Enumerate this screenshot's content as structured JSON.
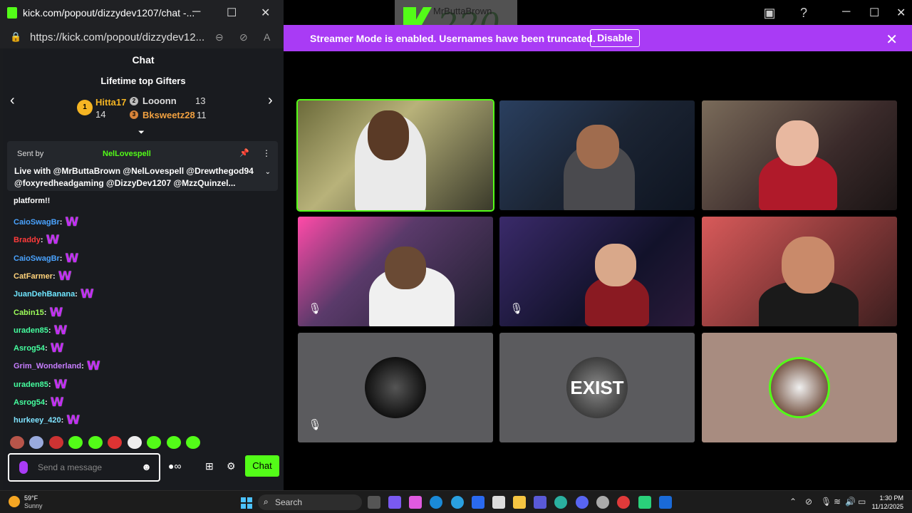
{
  "popout": {
    "window_title": "kick.com/popout/dizzydev1207/chat -...",
    "url": "https://kick.com/popout/dizzydev12...",
    "chat_title": "Chat",
    "lifetime_title": "Lifetime top Gifters",
    "gifters": [
      {
        "rank": "1",
        "name": "Hitta17",
        "count": "14"
      },
      {
        "rank": "2",
        "name": "Looonn",
        "count": "13"
      },
      {
        "rank": "3",
        "name": "Bksweetz28",
        "count": "11"
      }
    ],
    "pinned": {
      "sent_by": "Sent by",
      "author": "NelLovespell",
      "text": "Live with @MrButtaBrown @NelLovespell @Drewthegod94 @foxyredheadgaming @DizzyDev1207 @MzzQuinzel..."
    },
    "partial_message": "platform!!",
    "messages": [
      {
        "user": "CaioSwagBr",
        "color": "#4aa3ff"
      },
      {
        "user": "Braddy",
        "color": "#ff3b3b"
      },
      {
        "user": "CaioSwagBr",
        "color": "#4aa3ff"
      },
      {
        "user": "CatFarmer",
        "color": "#ffd27a"
      },
      {
        "user": "JuanDehBanana",
        "color": "#6fe6ff"
      },
      {
        "user": "Cabin15",
        "color": "#9dff5a"
      },
      {
        "user": "uraden85",
        "color": "#45ff9f"
      },
      {
        "user": "Asrog54",
        "color": "#45ff9f"
      },
      {
        "user": "Grim_Wonderland",
        "color": "#c77dff"
      },
      {
        "user": "uraden85",
        "color": "#45ff9f"
      },
      {
        "user": "Asrog54",
        "color": "#45ff9f"
      },
      {
        "user": "hurkeey_420",
        "color": "#7fe3ff"
      }
    ],
    "input_placeholder": "Send a message",
    "chat_button": "Chat"
  },
  "stage": {
    "banner_text": "Streamer Mode is enabled. Usernames have been truncated.",
    "banner_button": "Disable",
    "overlay_name": "MrButtaBrown",
    "overlay_number": "220",
    "avatar_text": "EXIST"
  },
  "taskbar": {
    "temperature": "59°F",
    "condition": "Sunny",
    "search_label": "Search",
    "time": "1:30 PM",
    "date": "11/12/2025"
  },
  "colors": {
    "kick_green": "#53fc18",
    "banner_purple": "#a93bf5"
  }
}
